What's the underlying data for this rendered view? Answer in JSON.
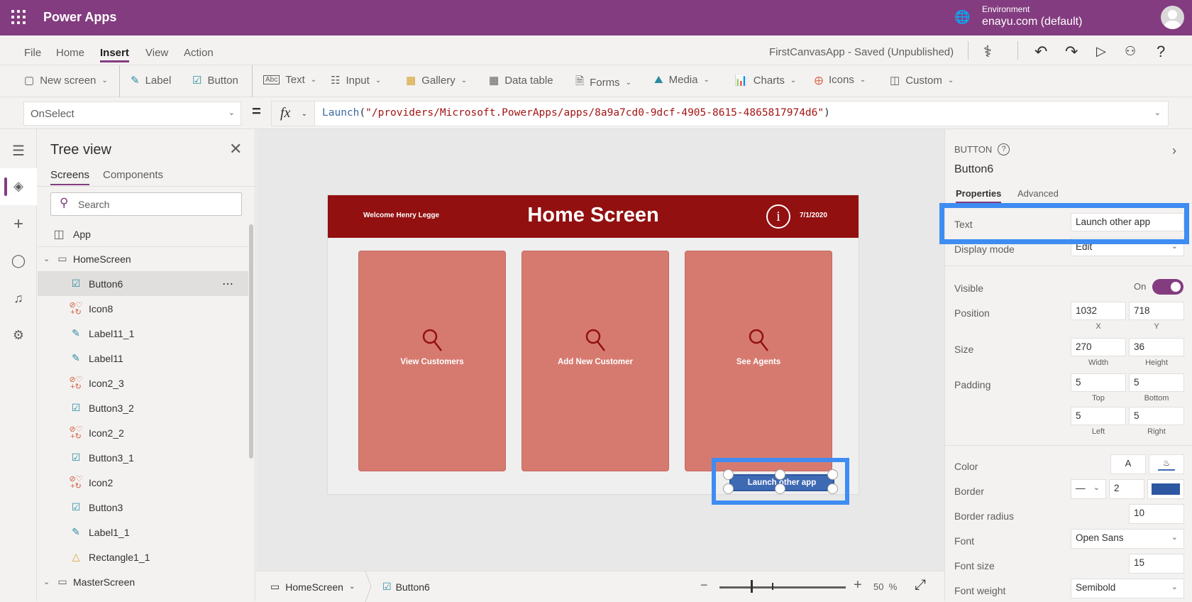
{
  "topbar": {
    "app_name": "Power Apps",
    "environment_label": "Environment",
    "environment_value": "enayu.com (default)"
  },
  "menu": {
    "items": [
      "File",
      "Home",
      "Insert",
      "View",
      "Action"
    ],
    "active": "Insert",
    "save_status": "FirstCanvasApp - Saved (Unpublished)"
  },
  "ribbon": {
    "new_screen": "New screen",
    "label": "Label",
    "button": "Button",
    "text": "Text",
    "input": "Input",
    "gallery": "Gallery",
    "data_table": "Data table",
    "forms": "Forms",
    "media": "Media",
    "charts": "Charts",
    "icons": "Icons",
    "custom": "Custom"
  },
  "formula_bar": {
    "property": "OnSelect",
    "equals": "=",
    "fx": "fx",
    "function_name": "Launch",
    "open_paren": "(",
    "string_arg": "\"/providers/Microsoft.PowerApps/apps/8a9a7cd0-9dcf-4905-8615-4865817974d6\"",
    "close_paren": ")"
  },
  "tree": {
    "title": "Tree view",
    "tabs": [
      "Screens",
      "Components"
    ],
    "active_tab": "Screens",
    "search_placeholder": "Search",
    "items": [
      {
        "label": "App",
        "type": "app",
        "level": 0
      },
      {
        "label": "HomeScreen",
        "type": "screen",
        "level": 0,
        "expanded": true
      },
      {
        "label": "Button6",
        "type": "button",
        "level": 1,
        "selected": true
      },
      {
        "label": "Icon8",
        "type": "icon",
        "level": 1
      },
      {
        "label": "Label11_1",
        "type": "label",
        "level": 1
      },
      {
        "label": "Label11",
        "type": "label",
        "level": 1
      },
      {
        "label": "Icon2_3",
        "type": "icon",
        "level": 1
      },
      {
        "label": "Button3_2",
        "type": "button",
        "level": 1
      },
      {
        "label": "Icon2_2",
        "type": "icon",
        "level": 1
      },
      {
        "label": "Button3_1",
        "type": "button",
        "level": 1
      },
      {
        "label": "Icon2",
        "type": "icon",
        "level": 1
      },
      {
        "label": "Button3",
        "type": "button",
        "level": 1
      },
      {
        "label": "Label1_1",
        "type": "label",
        "level": 1
      },
      {
        "label": "Rectangle1_1",
        "type": "rectangle",
        "level": 1
      },
      {
        "label": "MasterScreen",
        "type": "screen",
        "level": 0,
        "expanded": true
      }
    ]
  },
  "canvas": {
    "welcome": "Welcome Henry Legge",
    "title": "Home Screen",
    "date": "7/1/2020",
    "tiles": [
      "View Customers",
      "Add New Customer",
      "See Agents"
    ],
    "launch_button": "Launch other app",
    "header_color": "#921010",
    "tile_color": "#d67a70",
    "button_color": "#3e69b3"
  },
  "bottombar": {
    "screen": "HomeScreen",
    "control": "Button6",
    "zoom_percent": "50",
    "zoom_unit": "%"
  },
  "properties": {
    "control_type": "BUTTON",
    "control_name": "Button6",
    "tabs": [
      "Properties",
      "Advanced"
    ],
    "active_tab": "Properties",
    "text_label": "Text",
    "text_value": "Launch other app",
    "display_mode_label": "Display mode",
    "display_mode_value": "Edit",
    "visible_label": "Visible",
    "visible_value": "On",
    "visible": true,
    "position_label": "Position",
    "x": "1032",
    "y": "718",
    "x_label": "X",
    "y_label": "Y",
    "size_label": "Size",
    "width": "270",
    "height": "36",
    "width_label": "Width",
    "height_label": "Height",
    "padding_label": "Padding",
    "pad_top": "5",
    "pad_bottom": "5",
    "pad_left": "5",
    "pad_right": "5",
    "top_label": "Top",
    "bottom_label": "Bottom",
    "left_label": "Left",
    "right_label": "Right",
    "color_label": "Color",
    "color_text_glyph": "A",
    "border_label": "Border",
    "border_width": "2",
    "border_color": "#2d57a0",
    "border_radius_label": "Border radius",
    "border_radius": "10",
    "font_label": "Font",
    "font_value": "Open Sans",
    "font_size_label": "Font size",
    "font_size": "15",
    "font_weight_label": "Font weight",
    "font_weight": "Semibold"
  },
  "theme": {
    "brand": "#833c7f",
    "highlight": "#3f8cf2"
  }
}
